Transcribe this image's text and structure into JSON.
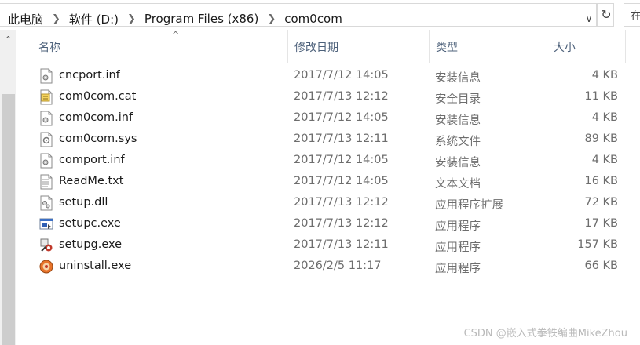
{
  "breadcrumb": [
    "此电脑",
    "软件 (D:)",
    "Program Files (x86)",
    "com0com"
  ],
  "search": {
    "label": "在"
  },
  "columns": {
    "name": "名称",
    "date": "修改日期",
    "type": "类型",
    "size": "大小"
  },
  "files": [
    {
      "name": "cncport.inf",
      "date": "2017/7/12 14:05",
      "type": "安装信息",
      "size": "4 KB",
      "icon": "inf-file-icon"
    },
    {
      "name": "com0com.cat",
      "date": "2017/7/13 12:12",
      "type": "安全目录",
      "size": "11 KB",
      "icon": "catalog-file-icon"
    },
    {
      "name": "com0com.inf",
      "date": "2017/7/12 14:05",
      "type": "安装信息",
      "size": "4 KB",
      "icon": "inf-file-icon"
    },
    {
      "name": "com0com.sys",
      "date": "2017/7/13 12:11",
      "type": "系统文件",
      "size": "89 KB",
      "icon": "sys-file-icon"
    },
    {
      "name": "comport.inf",
      "date": "2017/7/12 14:05",
      "type": "安装信息",
      "size": "4 KB",
      "icon": "inf-file-icon"
    },
    {
      "name": "ReadMe.txt",
      "date": "2017/7/12 14:05",
      "type": "文本文档",
      "size": "16 KB",
      "icon": "text-file-icon"
    },
    {
      "name": "setup.dll",
      "date": "2017/7/13 12:12",
      "type": "应用程序扩展",
      "size": "72 KB",
      "icon": "dll-file-icon"
    },
    {
      "name": "setupc.exe",
      "date": "2017/7/13 12:12",
      "type": "应用程序",
      "size": "17 KB",
      "icon": "console-exe-icon"
    },
    {
      "name": "setupg.exe",
      "date": "2017/7/13 12:11",
      "type": "应用程序",
      "size": "157 KB",
      "icon": "gui-exe-icon"
    },
    {
      "name": "uninstall.exe",
      "date": "2026/2/5 11:17",
      "type": "应用程序",
      "size": "66 KB",
      "icon": "uninstall-exe-icon"
    }
  ],
  "watermark": "CSDN @嵌入式拳铁编曲MikeZhou"
}
